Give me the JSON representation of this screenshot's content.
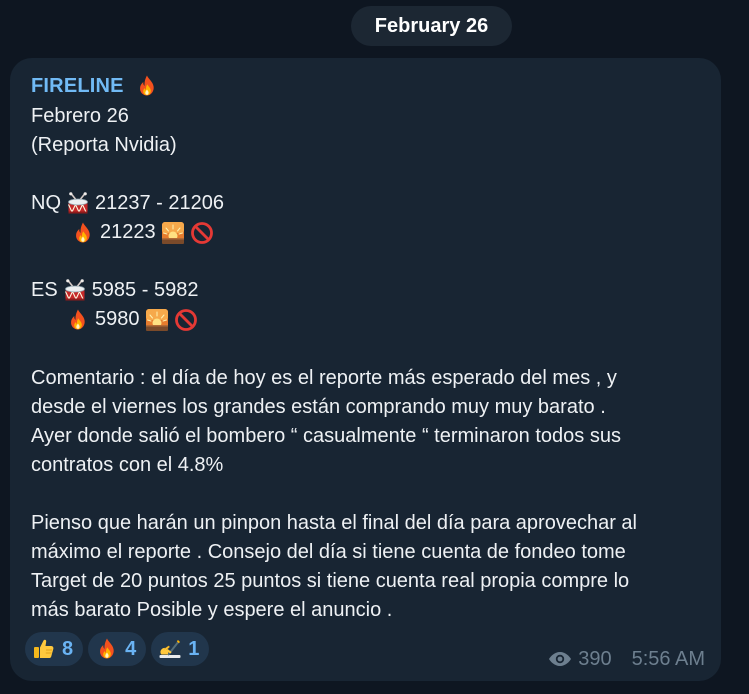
{
  "date_separator": "February 26",
  "message": {
    "sender": "FIRELINE",
    "sender_icon": "fire-icon",
    "lines": [
      "Febrero 26",
      "(Reporta Nvidia)",
      "NQ",
      "21237 - 21206",
      "21223",
      "ES",
      "5985 - 5982",
      "5980",
      "Comentario : el día de hoy es el reporte más esperado del mes , y",
      "desde el viernes los grandes están comprando muy muy barato .",
      "Ayer donde salió el bombero “ casualmente “ terminaron todos sus",
      "contratos con el 4.8%",
      "Pienso que harán un pinpon hasta el final del día para aprovechar al",
      "máximo el reporte . Consejo del día si tiene cuenta de fondeo tome",
      "Target de 20 puntos 25 puntos si tiene cuenta real propia compre lo",
      "más barato Posible y espere el anuncio ."
    ]
  },
  "reactions": [
    {
      "icon": "thumbs-up-icon",
      "count": "8"
    },
    {
      "icon": "fire-icon",
      "count": "4"
    },
    {
      "icon": "writing-hand-icon",
      "count": "1"
    }
  ],
  "meta": {
    "views": "390",
    "time": "5:56 AM"
  },
  "colors": {
    "background": "#0e1621",
    "bubble": "#182533",
    "sender": "#71baf5",
    "reaction_bg": "#21364c",
    "reaction_count": "#6ab3f3",
    "meta": "#6d7f8f"
  }
}
